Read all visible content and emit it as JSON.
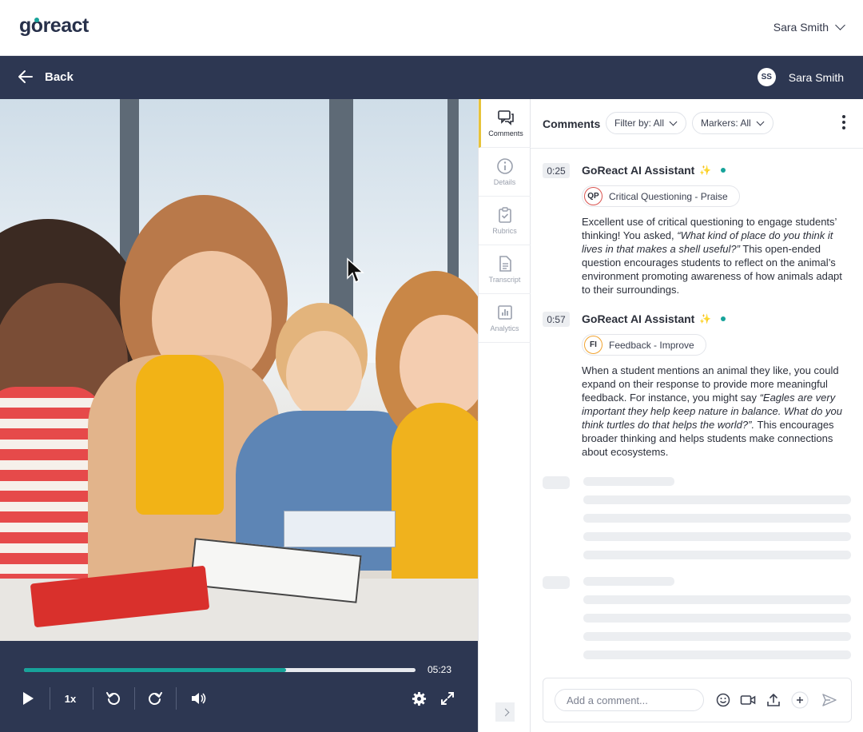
{
  "brand": {
    "logo_text_pre": "g",
    "logo_text_o": "o",
    "logo_text_post": "react",
    "accent": "#17a39a",
    "nav_bg": "#2d3752"
  },
  "topbar": {
    "user_name": "Sara Smith"
  },
  "navbar": {
    "back_label": "Back",
    "avatar_initials": "SS",
    "user_name": "Sara Smith"
  },
  "player": {
    "duration": "05:23",
    "progress_fraction": 0.67,
    "speed": "1x"
  },
  "rail": {
    "tabs": [
      {
        "label": "Comments",
        "icon": "comments-icon",
        "active": true
      },
      {
        "label": "Details",
        "icon": "info-icon",
        "active": false
      },
      {
        "label": "Rubrics",
        "icon": "rubric-icon",
        "active": false
      },
      {
        "label": "Transcript",
        "icon": "transcript-icon",
        "active": false
      },
      {
        "label": "Analytics",
        "icon": "analytics-icon",
        "active": false
      }
    ]
  },
  "comments_panel": {
    "title": "Comments",
    "filter_label": "Filter by: All",
    "markers_label": "Markers: All",
    "comments": [
      {
        "time": "0:25",
        "author": "GoReact AI Assistant",
        "tag_code": "QP",
        "tag_label": "Critical Questioning - Praise",
        "text_a": "Excellent use of critical questioning to engage students’ thinking! You asked, ",
        "text_quote": "“What kind of place do you think it lives in that makes a shell useful?”",
        "text_b": " This open-ended question encourages students to reflect on the animal’s environment promoting awareness of how animals adapt to their surroundings."
      },
      {
        "time": "0:57",
        "author": "GoReact AI Assistant",
        "tag_code": "FI",
        "tag_label": "Feedback - Improve",
        "text_a": "When a student mentions an animal they like, you could expand on their response to provide more meaningful feedback. For instance, you might say ",
        "text_quote": "“Eagles are very important they help keep nature in balance. What do you think turtles do that helps the world?”.",
        "text_b": " This encourages broader thinking and helps students make connections about ecosystems."
      }
    ],
    "composer": {
      "placeholder": "Add a comment..."
    }
  }
}
